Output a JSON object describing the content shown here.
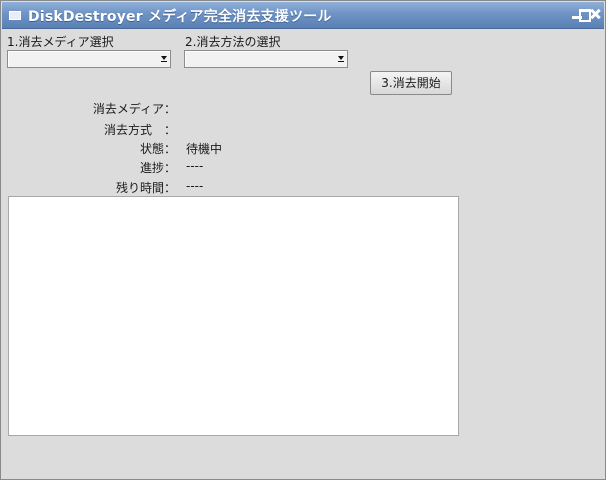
{
  "window": {
    "title": "DiskDestroyer メディア完全消去支援ツール"
  },
  "media": {
    "label": "1.消去メディア選択",
    "selected": ""
  },
  "method": {
    "label": "2.消去方法の選択",
    "selected": ""
  },
  "start_button": "3.消去開始",
  "info": [
    {
      "key": "消去メディア：",
      "value": ""
    },
    {
      "key": "消去方式　：",
      "value": ""
    },
    {
      "key": "状態：",
      "value": "待機中"
    },
    {
      "key": "進捗：",
      "value": "----"
    },
    {
      "key": "残り時間：",
      "value": "----"
    }
  ],
  "log": {
    "text": ""
  }
}
